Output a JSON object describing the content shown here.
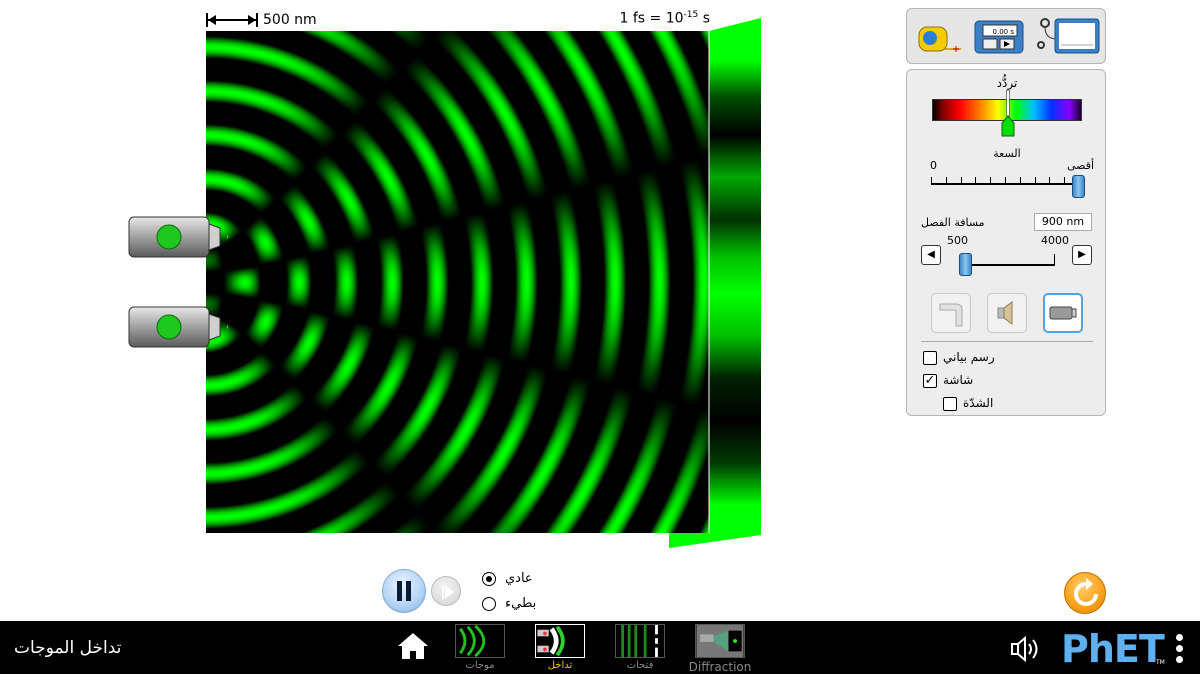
{
  "scale": {
    "length_label": "500 nm",
    "time_label": "1 fs = 10",
    "time_exp": "-15",
    "time_unit": " s"
  },
  "controls": {
    "frequency_title": "تردُّد",
    "amplitude_title": "السعة",
    "amplitude_min": "0",
    "amplitude_max": "أقصى",
    "amplitude_level": 1.0,
    "separation_label": "مسافة الفصل",
    "separation_value": "900 nm",
    "separation_min": "500",
    "separation_max": "4000",
    "checkboxes": {
      "graph": {
        "label": "رسم بياني",
        "checked": false
      },
      "screen": {
        "label": "شاشة",
        "checked": true
      },
      "intensity": {
        "label": "الشدّة",
        "checked": false
      }
    },
    "source_buttons": [
      "water-faucet-icon",
      "speaker-icon",
      "laser-icon"
    ],
    "selected_source": "laser"
  },
  "playback": {
    "speed_normal": "عادي",
    "speed_slow": "بطيء",
    "selected": "normal"
  },
  "nav": {
    "app_title": "تداخل الموجات",
    "tabs": [
      {
        "label": "موجات",
        "selected": false
      },
      {
        "label": "تداخل",
        "selected": true
      },
      {
        "label": "فتحات",
        "selected": false
      },
      {
        "label": "Diffraction",
        "selected": false
      }
    ],
    "logo": "PhET",
    "logo_tm": "TM"
  },
  "colors": {
    "wave": "#00ff00",
    "accent": "#52a3e0",
    "reset": "#f7a019"
  }
}
